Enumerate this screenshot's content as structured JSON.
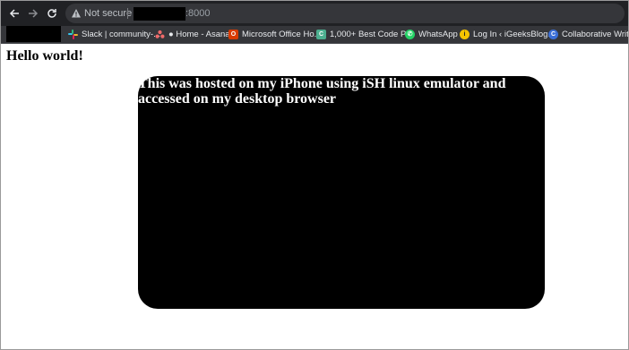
{
  "toolbar": {
    "back_icon": "arrow-left-icon",
    "forward_icon": "arrow-right-icon",
    "reload_icon": "reload-icon",
    "security_icon": "warning-triangle-icon",
    "security_label": "Not secure",
    "url_port": ":8000"
  },
  "bookmarks": [
    {
      "label": "Slack | community-...",
      "icon": "slack-icon",
      "color": "#e01e5a"
    },
    {
      "label": "● Home - Asana",
      "icon": "asana-icon",
      "color": "#f06a6a"
    },
    {
      "label": "Microsoft Office Ho...",
      "icon": "office-icon",
      "color": "#d83b01"
    },
    {
      "label": "1,000+ Best Code P...",
      "icon": "codepen-icon",
      "color": "#4caf8f"
    },
    {
      "label": "WhatsApp",
      "icon": "whatsapp-icon",
      "color": "#25d366"
    },
    {
      "label": "Log In ‹ iGeeksBlog...",
      "icon": "igeeksblog-icon",
      "color": "#f5c400"
    },
    {
      "label": "Collaborative Writin...",
      "icon": "collaborative-writing-icon",
      "color": "#3b6fd8"
    }
  ],
  "page": {
    "heading": "Hello world!",
    "card_text": "This was hosted on my iPhone using iSH linux emulator and accessed on my desktop browser"
  }
}
